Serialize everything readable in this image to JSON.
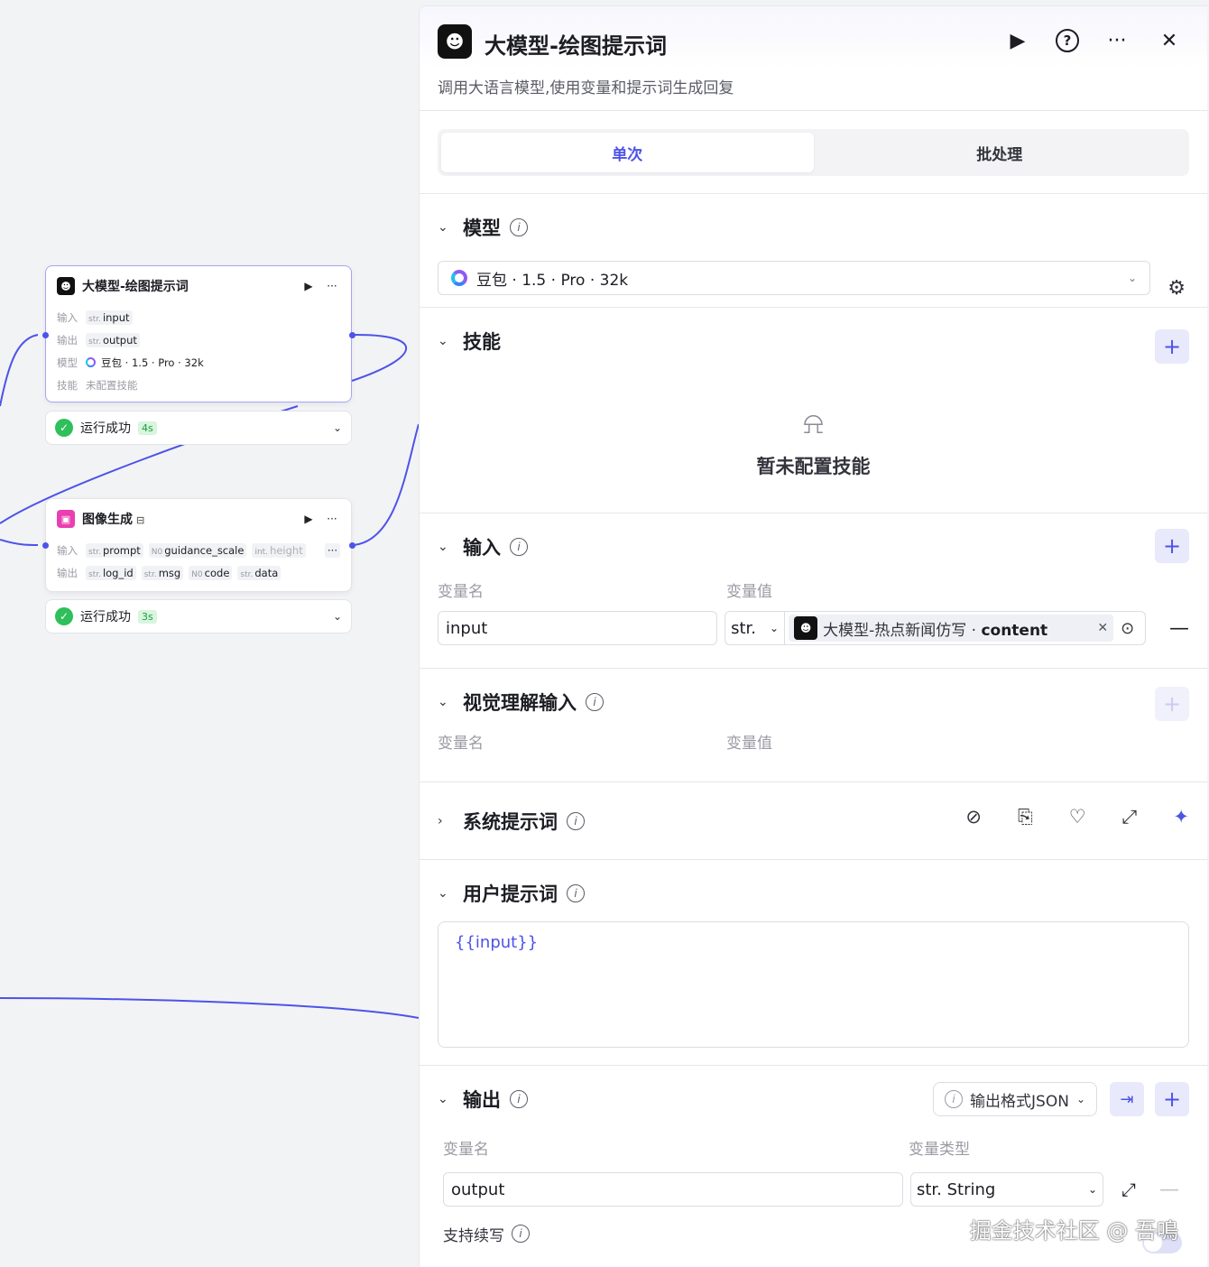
{
  "canvas": {
    "node1": {
      "title": "大模型-绘图提示词",
      "run_icon": "▶",
      "more_icon": "···",
      "input_label": "输入",
      "input_type": "str.",
      "input_name": "input",
      "output_label": "输出",
      "output_type": "str.",
      "output_name": "output",
      "model_label": "模型",
      "model_value": "豆包 · 1.5 · Pro · 32k",
      "skill_label": "技能",
      "skill_value": "未配置技能"
    },
    "status1": {
      "text": "运行成功",
      "time": "4s"
    },
    "node2": {
      "title": "图像生成",
      "title_icon": "⊟",
      "run_icon": "▶",
      "more_icon": "···",
      "input_label": "输入",
      "inputs": [
        {
          "type": "str.",
          "name": "prompt"
        },
        {
          "type": "N0",
          "name": "guidance_scale"
        },
        {
          "type": "int.",
          "name": "height"
        }
      ],
      "overflow": "···",
      "output_label": "输出",
      "outputs": [
        {
          "type": "str.",
          "name": "log_id"
        },
        {
          "type": "str.",
          "name": "msg"
        },
        {
          "type": "N0",
          "name": "code"
        },
        {
          "type": "str.",
          "name": "data"
        }
      ]
    },
    "status2": {
      "text": "运行成功",
      "time": "3s"
    }
  },
  "panel": {
    "title": "大模型-绘图提示词",
    "description": "调用大语言模型,使用变量和提示词生成回复",
    "tabs": [
      "单次",
      "批处理"
    ],
    "model": {
      "title": "模型",
      "value": "豆包 · 1.5 · Pro · 32k"
    },
    "skills": {
      "title": "技能",
      "empty": "暂未配置技能"
    },
    "input": {
      "title": "输入",
      "col_name": "变量名",
      "col_value": "变量值",
      "row_name": "input",
      "row_type": "str.",
      "ref_source": "大模型-热点新闻仿写 · ",
      "ref_var": "content"
    },
    "vision": {
      "title": "视觉理解输入",
      "col_name": "变量名",
      "col_value": "变量值"
    },
    "system_prompt": {
      "title": "系统提示词"
    },
    "user_prompt": {
      "title": "用户提示词",
      "value": "{{input}}"
    },
    "output": {
      "title": "输出",
      "format": "输出格式JSON",
      "col_name": "变量名",
      "col_type": "变量类型",
      "row_name": "output",
      "row_type": "str. String",
      "continue_label": "支持续写"
    },
    "watermark": "掘金技术社区 @ 吾鳴"
  },
  "colors": {
    "accent": "#4d53e8",
    "success": "#2fbf5b",
    "border": "#dcdde3"
  }
}
